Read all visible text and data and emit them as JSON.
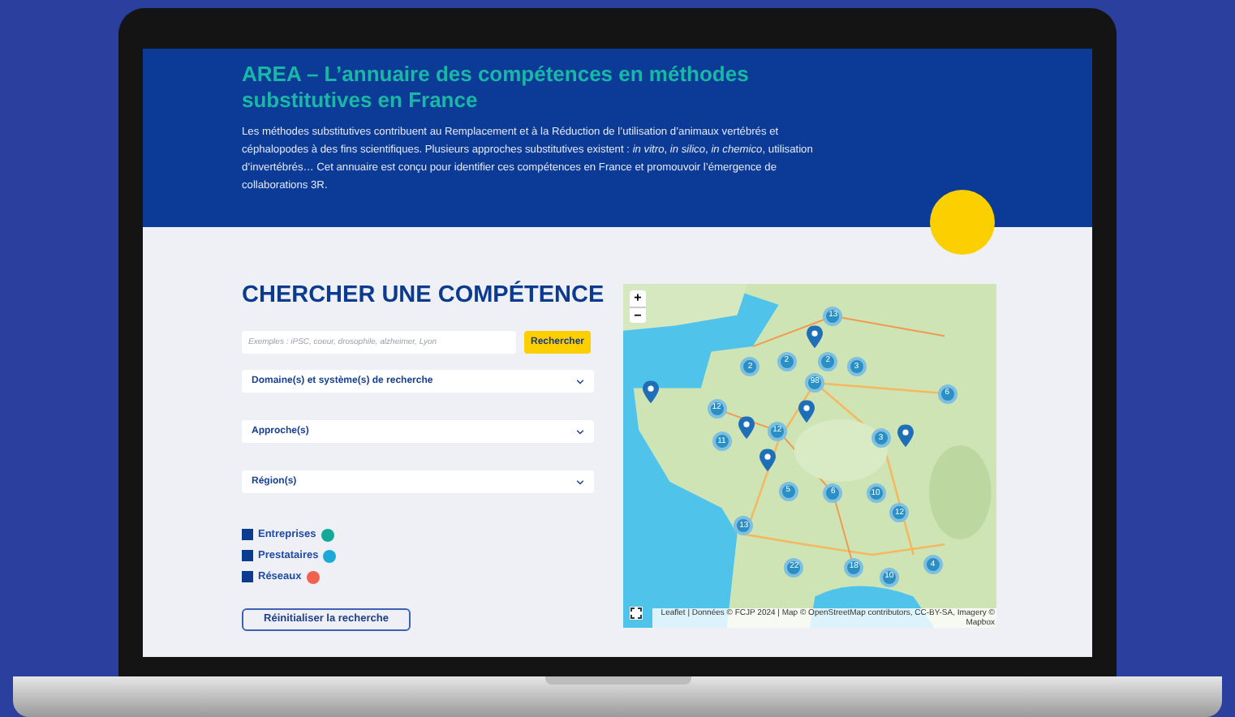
{
  "header": {
    "title": "AREA – L’annuaire des compétences en méthodes substitutives en France",
    "intro": "Les méthodes substitutives contribuent au Remplacement et à la Réduction de l’utilisation d’animaux vertébrés et céphalopodes à des fins scientifiques. Plusieurs approches substitutives existent : *in vitro*, *in silico*, *in chemico*, utilisation d’invertébrés… Cet annuaire est conçu pour identifier ces compétences en France et promouvoir l’émergence de collaborations 3R."
  },
  "search": {
    "title": "CHERCHER UNE COMPÉTENCE",
    "placeholder": "Exemples : iPSC, coeur, drosophile, alzheimer, Lyon",
    "button": "Rechercher"
  },
  "dropdowns": [
    "Domaine(s) et système(s) de recherche",
    "Approche(s)",
    "Région(s)"
  ],
  "filters": [
    {
      "label": "Entreprises",
      "checked": true,
      "color": "#14a89a"
    },
    {
      "label": "Prestataires",
      "checked": true,
      "color": "#1ca9d8"
    },
    {
      "label": "Réseaux",
      "checked": true,
      "color": "#f0624d"
    }
  ],
  "reset_button": "Réinitialiser la recherche",
  "map": {
    "zoom_in": "+",
    "zoom_out": "−",
    "attribution": "Leaflet | Données © FCJP 2024 | Map © OpenStreetMap contributors, CC-BY-SA, Imagery © Mapbox",
    "clusters": [
      "13",
      "2",
      "2",
      "2",
      "3",
      "98",
      "12",
      "12",
      "11",
      "6",
      "3",
      "5",
      "6",
      "10",
      "12",
      "13",
      "22",
      "18",
      "10",
      "4"
    ]
  }
}
